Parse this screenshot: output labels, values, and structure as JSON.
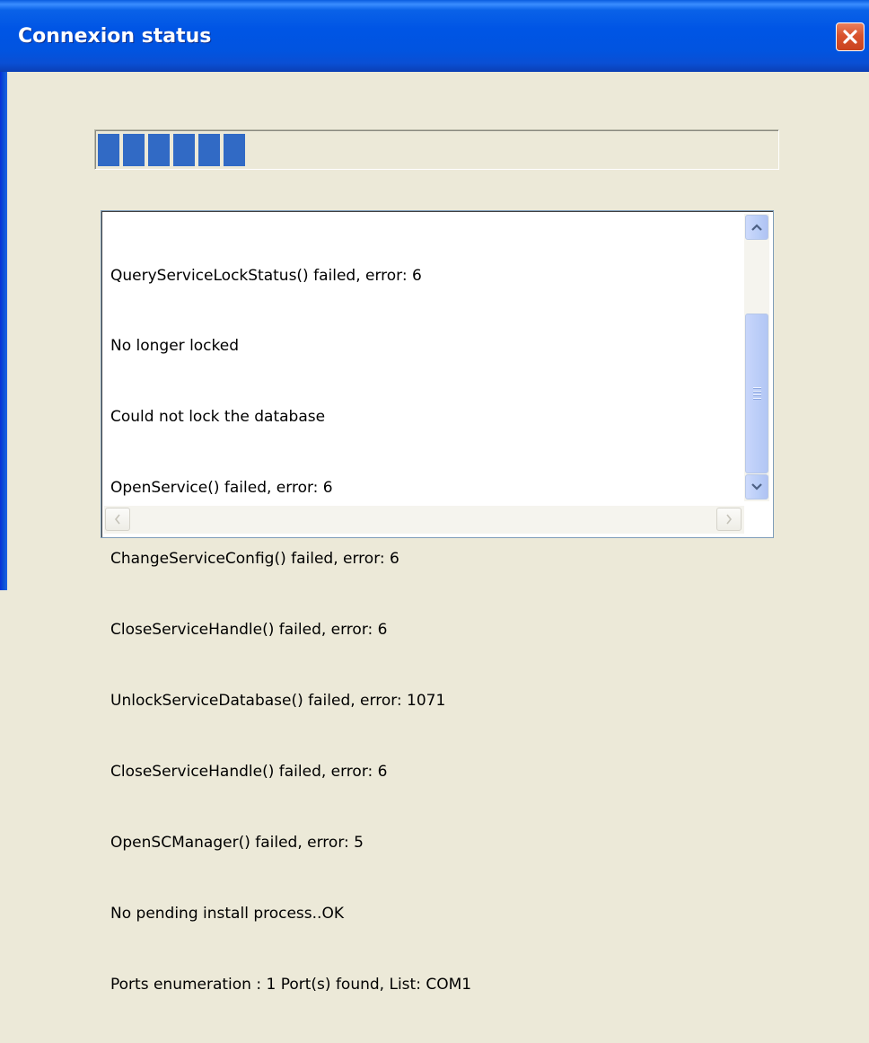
{
  "window": {
    "title": "Connexion status",
    "close_icon": "close-icon"
  },
  "progress": {
    "filled_blocks": 6,
    "block_color": "#316ac5"
  },
  "log": {
    "lines": [
      "QueryServiceLockStatus() failed, error: 6",
      "No longer locked",
      "Could not lock the database",
      "OpenService() failed, error: 6",
      "ChangeServiceConfig() failed, error: 6",
      "CloseServiceHandle() failed, error: 6",
      "UnlockServiceDatabase() failed, error: 1071",
      "CloseServiceHandle() failed, error: 6",
      "OpenSCManager() failed, error: 5",
      "No pending install process..OK",
      "Ports enumeration : 1 Port(s) found, List: COM1"
    ]
  },
  "colors": {
    "titlebar": "#0055e5",
    "client_bg": "#ece9d8",
    "close_button": "#d9532d"
  }
}
